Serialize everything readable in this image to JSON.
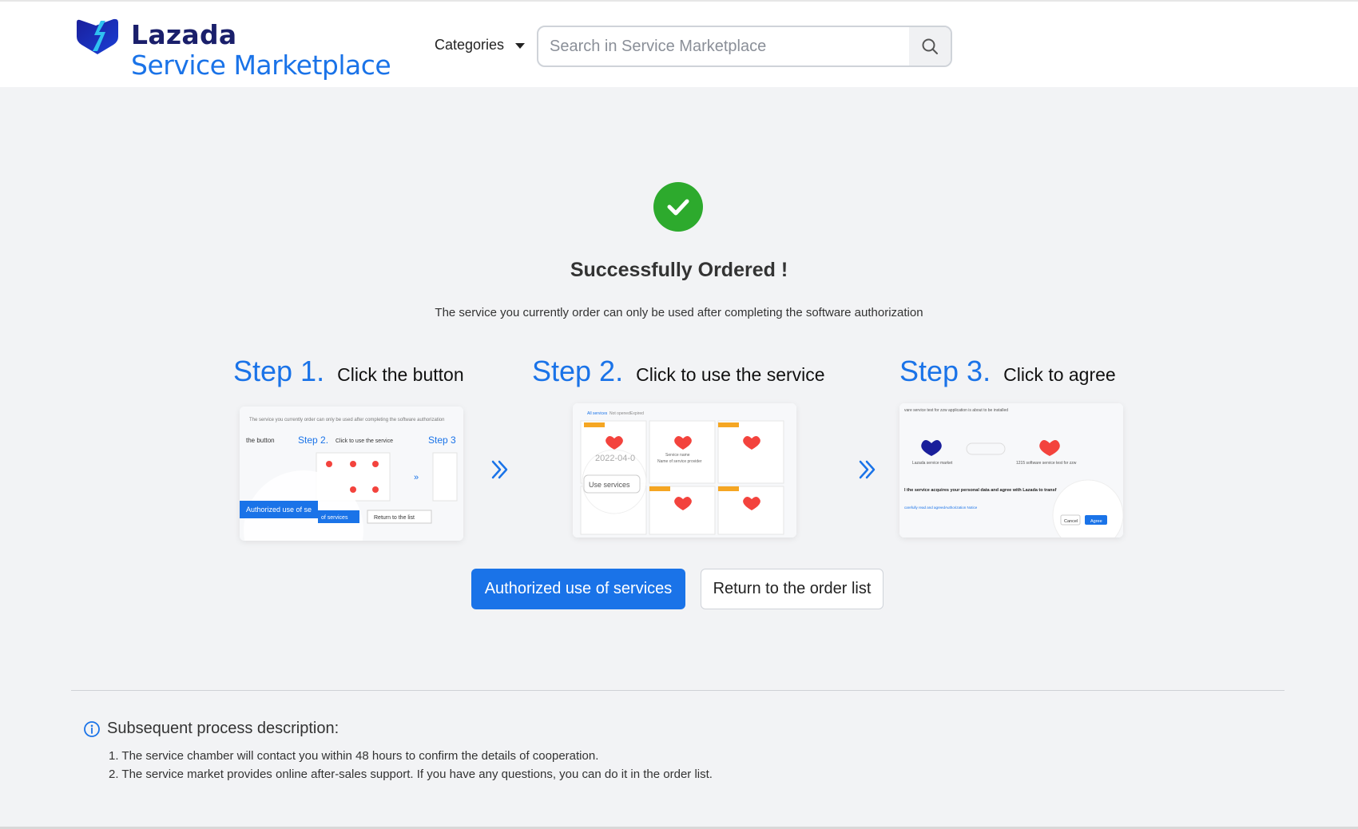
{
  "header": {
    "brand_top": "Lazada",
    "brand_bottom": "Service Marketplace",
    "categories_label": "Categories",
    "search_placeholder": "Search in Service Marketplace"
  },
  "status": {
    "title": "Successfully Ordered !",
    "subtitle": "The service you currently order can only be used after completing the software authorization"
  },
  "steps": [
    {
      "number": "Step 1.",
      "text": "Click the button",
      "preview": {
        "top_text": "The service you currently order can only be used after completing the software authorization",
        "label_a": "the button",
        "step2": "Step 2.",
        "step2_text": "Click to use the service",
        "step3": "Step 3",
        "primary": "Authorized use of se",
        "primary_tail": "of services",
        "secondary": "Return to the list"
      }
    },
    {
      "number": "Step 2.",
      "text": "Click to use the service",
      "preview": {
        "tab1": "All services",
        "tab2": "Not opened",
        "tab3": "Expired",
        "date": "2022-04-0",
        "use_btn": "Use services",
        "card_name": "Service name",
        "card_provider": "Name of service provider"
      }
    },
    {
      "number": "Step 3.",
      "text": "Click to agree",
      "preview": {
        "top_text": "vare service test for zzw application is about to be installed",
        "left_label": "Lazada service market",
        "right_label": "1215 software service test for zzw",
        "consent": "l the service acquires your personal data and agree with Lazada to transf",
        "notice": "carefully read and agreedAuthorization Notice",
        "cancel": "Cancel",
        "agree": "Agree"
      }
    }
  ],
  "actions": {
    "primary_label": "Authorized use of services",
    "secondary_label": "Return to the order list"
  },
  "description": {
    "title": "Subsequent process description:",
    "items": [
      "1. The service chamber will contact you within 48 hours to confirm the details of cooperation.",
      "2. The service market provides online after-sales support. If you have any questions, you can do it in the order list."
    ]
  },
  "colors": {
    "accent": "#1a73e8",
    "success": "#2daa2d",
    "brand_dark": "#1a1f6b",
    "background": "#f2f3f5"
  },
  "icons": [
    "lazada-logo-icon",
    "caret-down-icon",
    "search-icon",
    "check-circle-icon",
    "double-chevron-right-icon",
    "info-circle-icon"
  ]
}
